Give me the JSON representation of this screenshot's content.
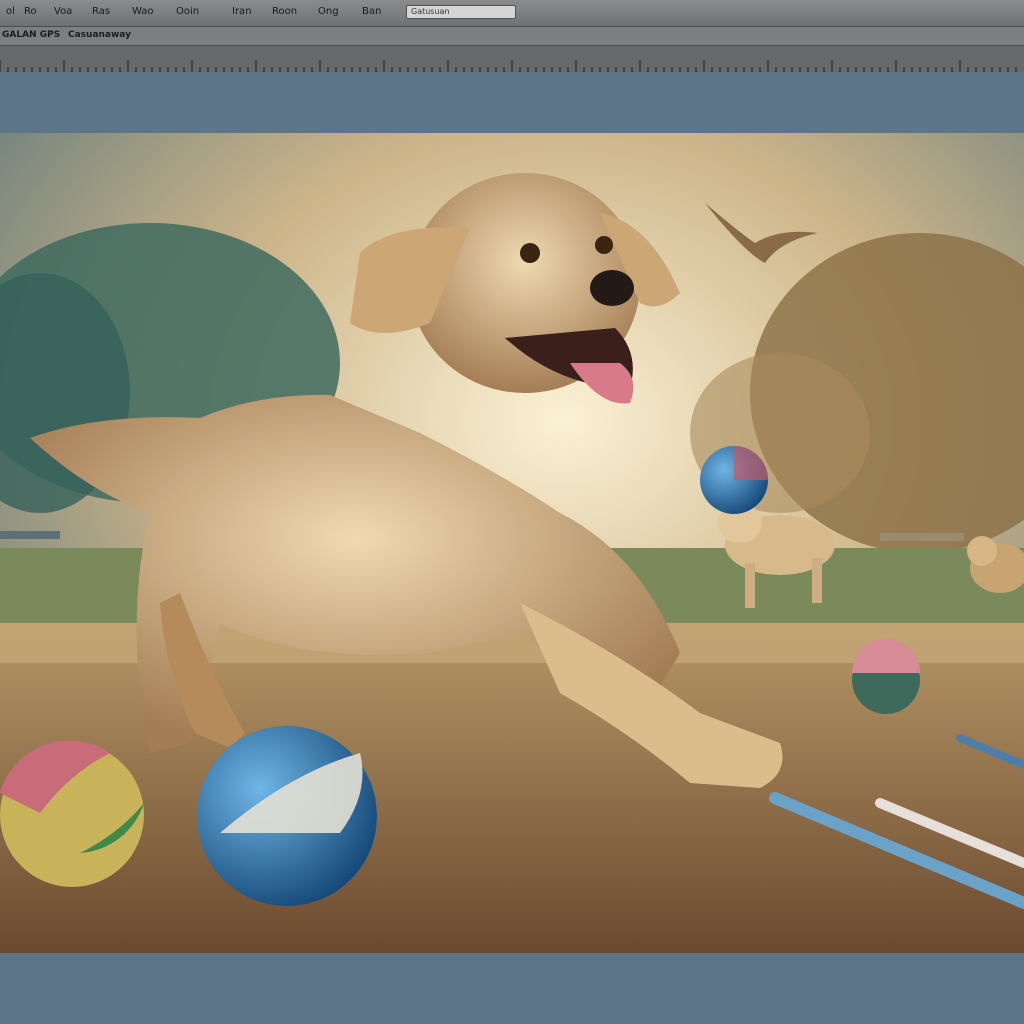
{
  "menubar": {
    "items": [
      "ol",
      "Ro",
      "Voa",
      "Ras",
      "Wao",
      "Ooin",
      "Iran",
      "Roon",
      "Ong",
      "Ban"
    ],
    "search_value": "Gatusuan"
  },
  "toolbar": {
    "left_label": "GALAN GPS",
    "right_label": "Casuanaway"
  },
  "canvas": {
    "description_icon": "dog-painting-image"
  },
  "colors": {
    "workspace": "#5d7588",
    "menubar": "#7a7c7d"
  }
}
